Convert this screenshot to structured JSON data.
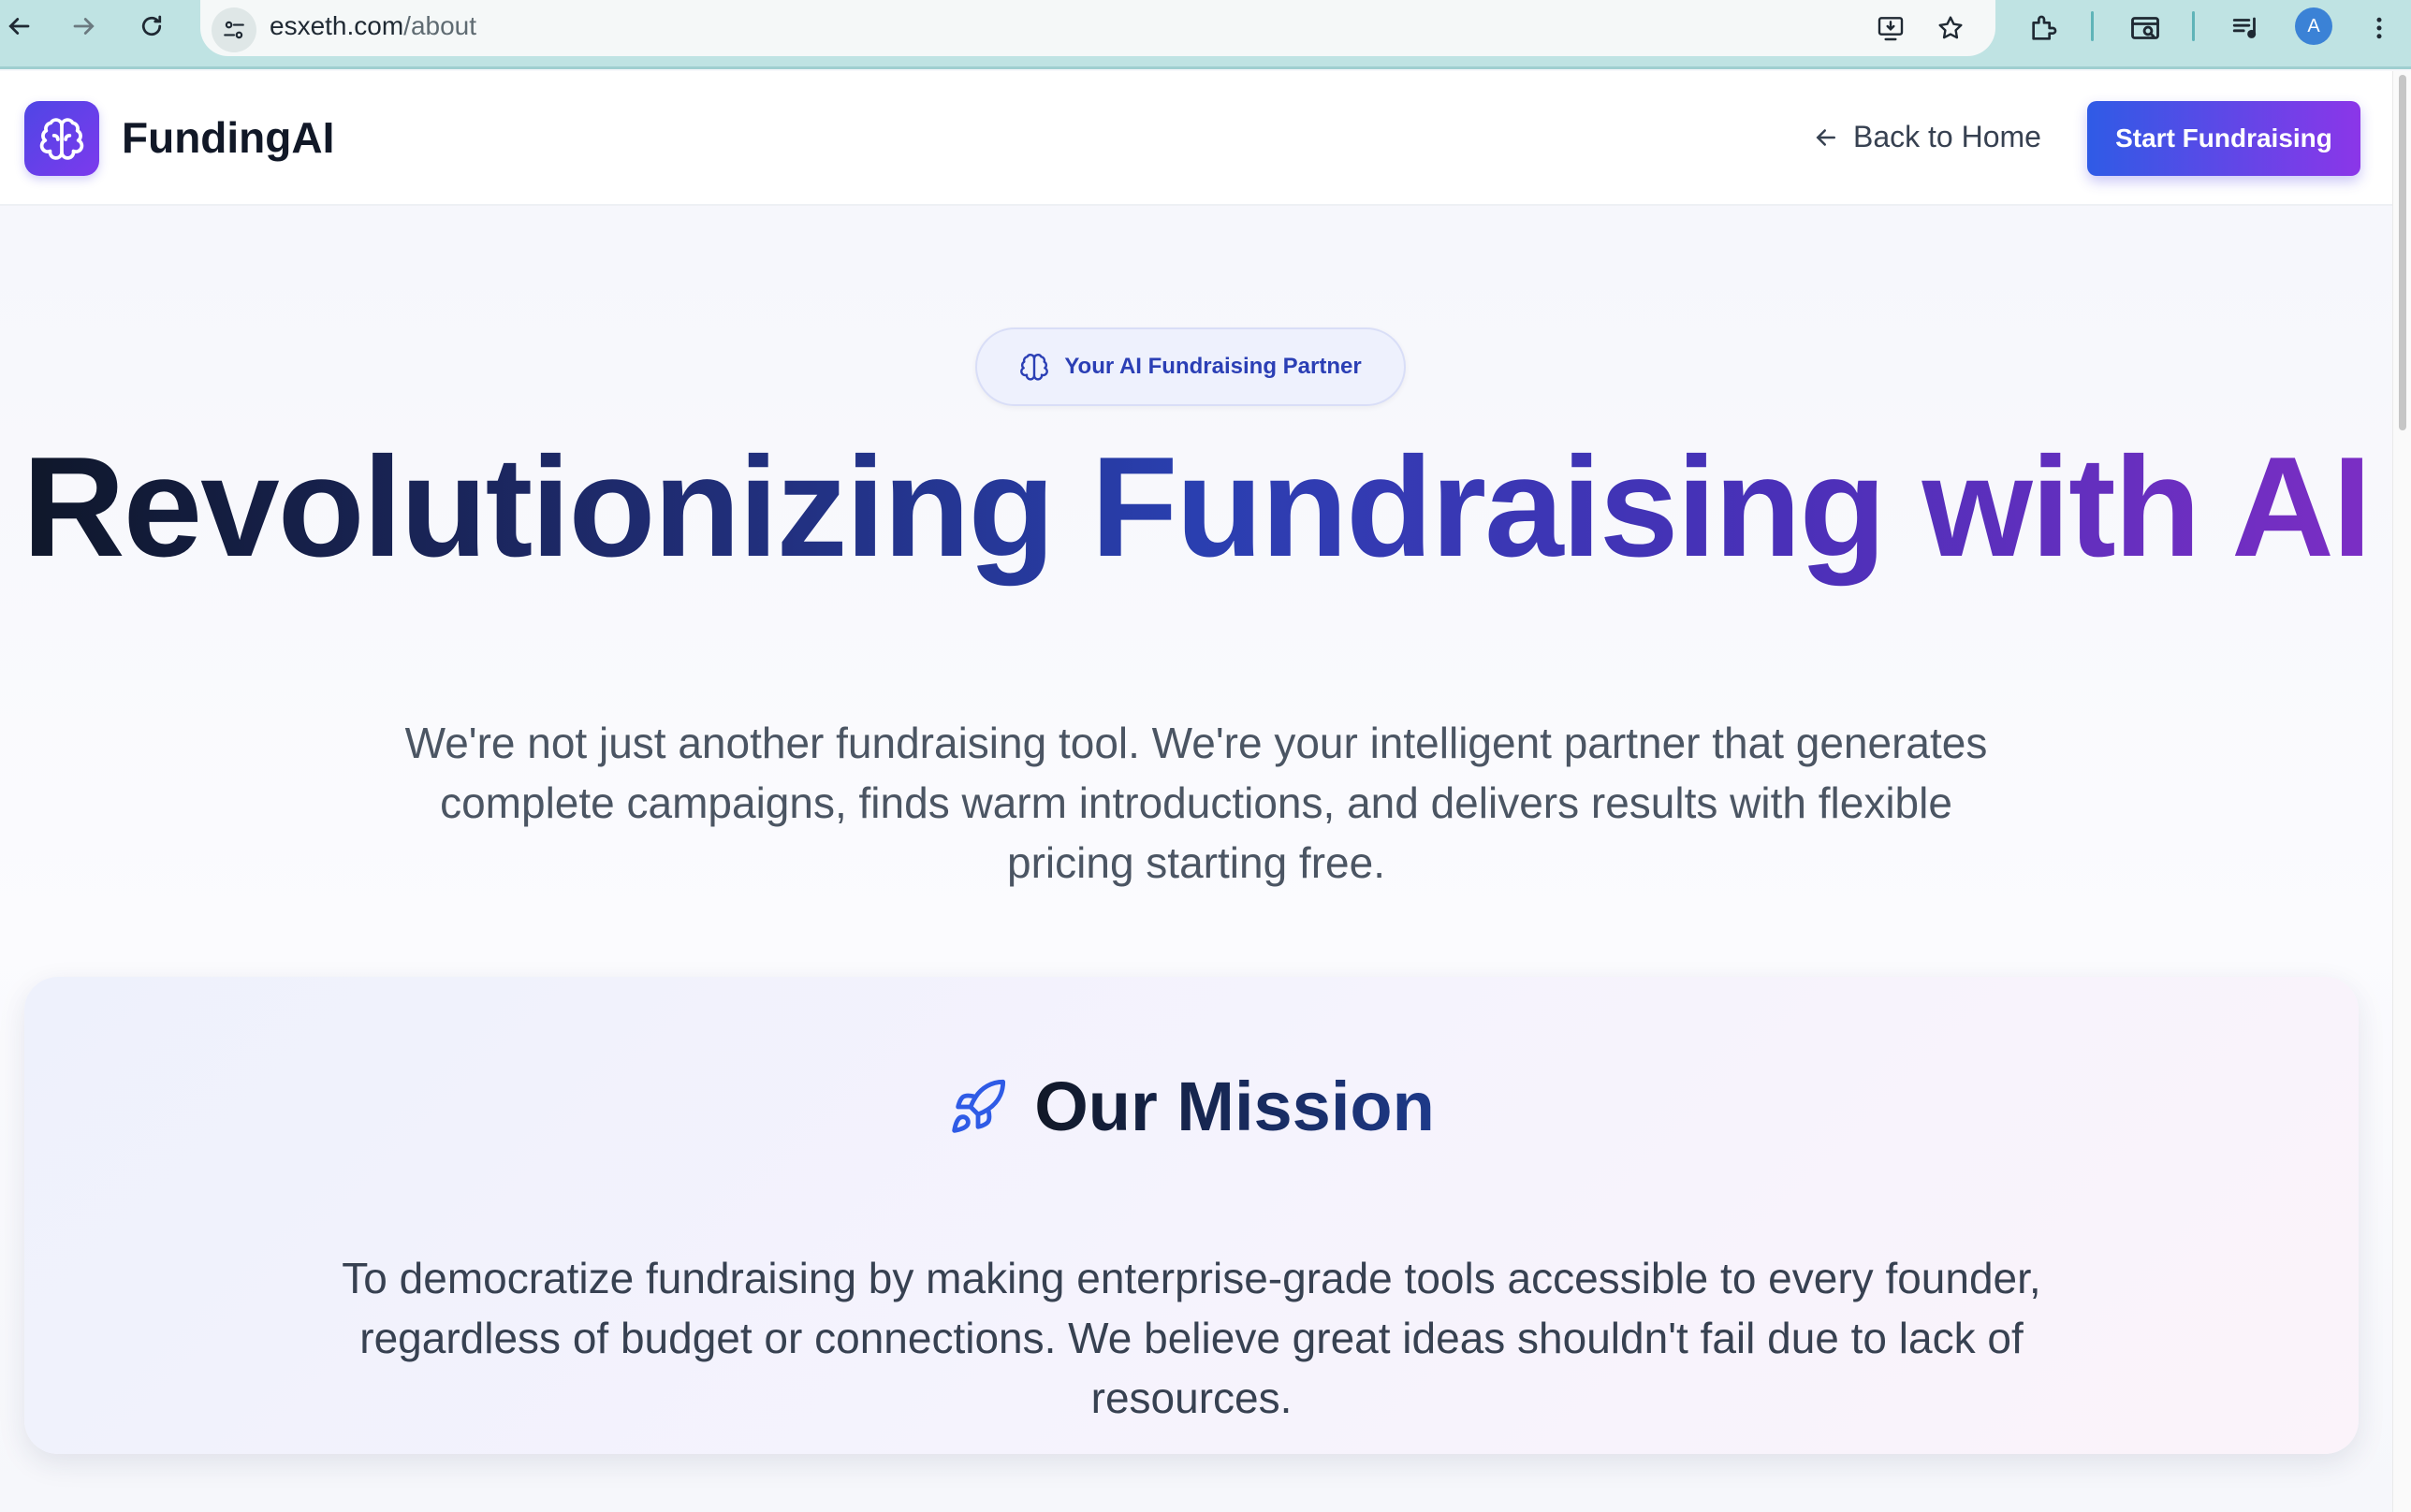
{
  "browser": {
    "url_host": "esxeth.com",
    "url_path": "/about",
    "profile_initial": "A",
    "icons": [
      "back-arrow-icon",
      "forward-arrow-icon",
      "reload-icon",
      "site-info-icon",
      "install-app-icon",
      "star-icon",
      "extensions-icon",
      "search-tab-icon",
      "media-control-icon",
      "more-menu-icon"
    ]
  },
  "header": {
    "brand": "FundingAI",
    "logo_icon": "brain-icon",
    "back_link": "Back to Home",
    "cta": "Start Fundraising"
  },
  "hero": {
    "badge": "Your AI Fundraising Partner",
    "title": "Revolutionizing Fundraising with AI",
    "subtitle": "We're not just another fundraising tool. We're your intelligent partner that generates complete campaigns, finds warm introductions, and delivers results with flexible pricing starting free."
  },
  "mission": {
    "icon": "rocket-icon",
    "title": "Our Mission",
    "text": "To democratize fundraising by making enterprise-grade tools accessible to every founder, regardless of budget or connections. We believe great ideas shouldn't fail due to lack of resources."
  },
  "colors": {
    "brand_gradient_start": "#4f46e5",
    "brand_gradient_end": "#7c3aed",
    "cta_start": "#2f5be6",
    "cta_end": "#8b36e8",
    "chrome": "#bfe3e3"
  }
}
